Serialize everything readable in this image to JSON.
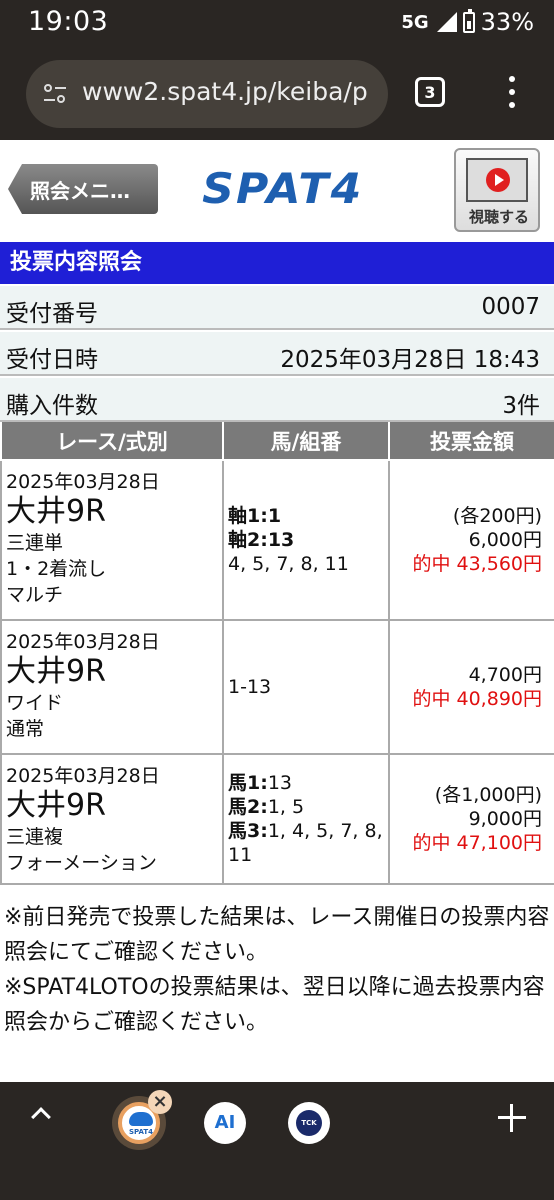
{
  "status": {
    "time": "19:03",
    "network": "5G",
    "battery": "33%"
  },
  "browser": {
    "url": "www2.spat4.jp/keiba/p",
    "tab_count": "3"
  },
  "header": {
    "back_label": "照会メニ…",
    "logo": "SPAT4",
    "watch_label": "視聴する"
  },
  "page_title": "投票内容照会",
  "info": [
    {
      "label": "受付番号",
      "value": "0007"
    },
    {
      "label": "受付日時",
      "value": "2025年03月28日 18:43"
    },
    {
      "label": "購入件数",
      "value": "3件"
    }
  ],
  "table": {
    "headers": [
      "レース/式別",
      "馬/組番",
      "投票金額"
    ],
    "rows": [
      {
        "date": "2025年03月28日",
        "venue": "大井9R",
        "type": "三連単",
        "method": "1・2着流し",
        "method2": "マルチ",
        "combo_lines": [
          {
            "label": "軸1:",
            "value": "1"
          },
          {
            "label": "軸2:",
            "value": "13"
          }
        ],
        "combo_plain": "4, 5, 7, 8, 11",
        "unit": "(各200円)",
        "amount": "6,000円",
        "hit": "的中  43,560円"
      },
      {
        "date": "2025年03月28日",
        "venue": "大井9R",
        "type": "ワイド",
        "method": "通常",
        "combo_plain": "1-13",
        "amount": "4,700円",
        "hit": "的中  40,890円"
      },
      {
        "date": "2025年03月28日",
        "venue": "大井9R",
        "type": "三連複",
        "method": "フォーメーション",
        "combo_lines": [
          {
            "label": "馬1:",
            "value": "13"
          },
          {
            "label": "馬2:",
            "value": "1, 5"
          },
          {
            "label": "馬3:",
            "value": "1, 4, 5, 7, 8,"
          }
        ],
        "combo_plain": "11",
        "unit": "(各1,000円)",
        "amount": "9,000円",
        "hit": "的中  47,100円"
      }
    ]
  },
  "notes": [
    "※前日発売で投票した結果は、レース開催日の投票内容照会にてご確認ください。",
    "※SPAT4LOTOの投票結果は、翌日以降に過去投票内容照会からご確認ください。"
  ],
  "bottom": {
    "tab1_caption": "SPAT4",
    "tab2_label": "AI",
    "tab3_caption": "TCK",
    "close_glyph": "×"
  }
}
